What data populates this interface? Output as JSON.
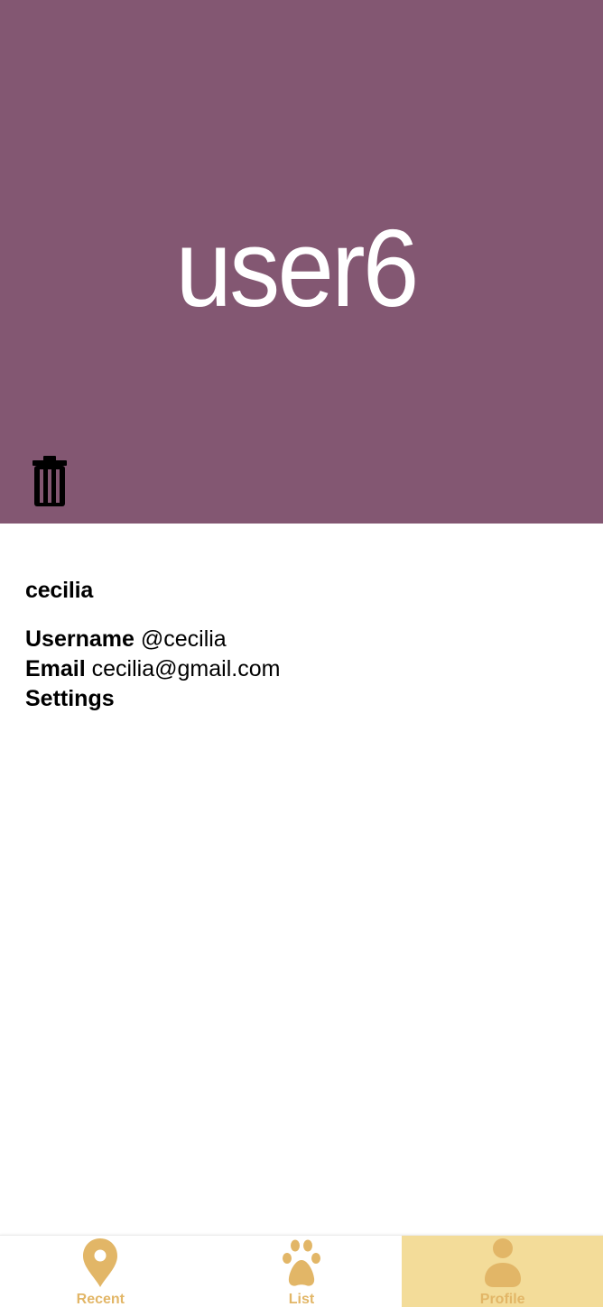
{
  "header": {
    "banner_text": "user6",
    "banner_color": "#835772"
  },
  "actions": {
    "delete_icon": "trash-icon"
  },
  "profile": {
    "display_name": "cecilia",
    "username_label": "Username",
    "username_value": "@cecilia",
    "email_label": "Email",
    "email_value": "cecilia@gmail.com",
    "settings_label": "Settings"
  },
  "bottom_nav": {
    "accent_color": "#e2b667",
    "active_background": "#f3dc99",
    "items": [
      {
        "label": "Recent",
        "icon": "map-pin-icon",
        "active": false
      },
      {
        "label": "List",
        "icon": "paw-icon",
        "active": false
      },
      {
        "label": "Profile",
        "icon": "person-icon",
        "active": true
      }
    ]
  }
}
